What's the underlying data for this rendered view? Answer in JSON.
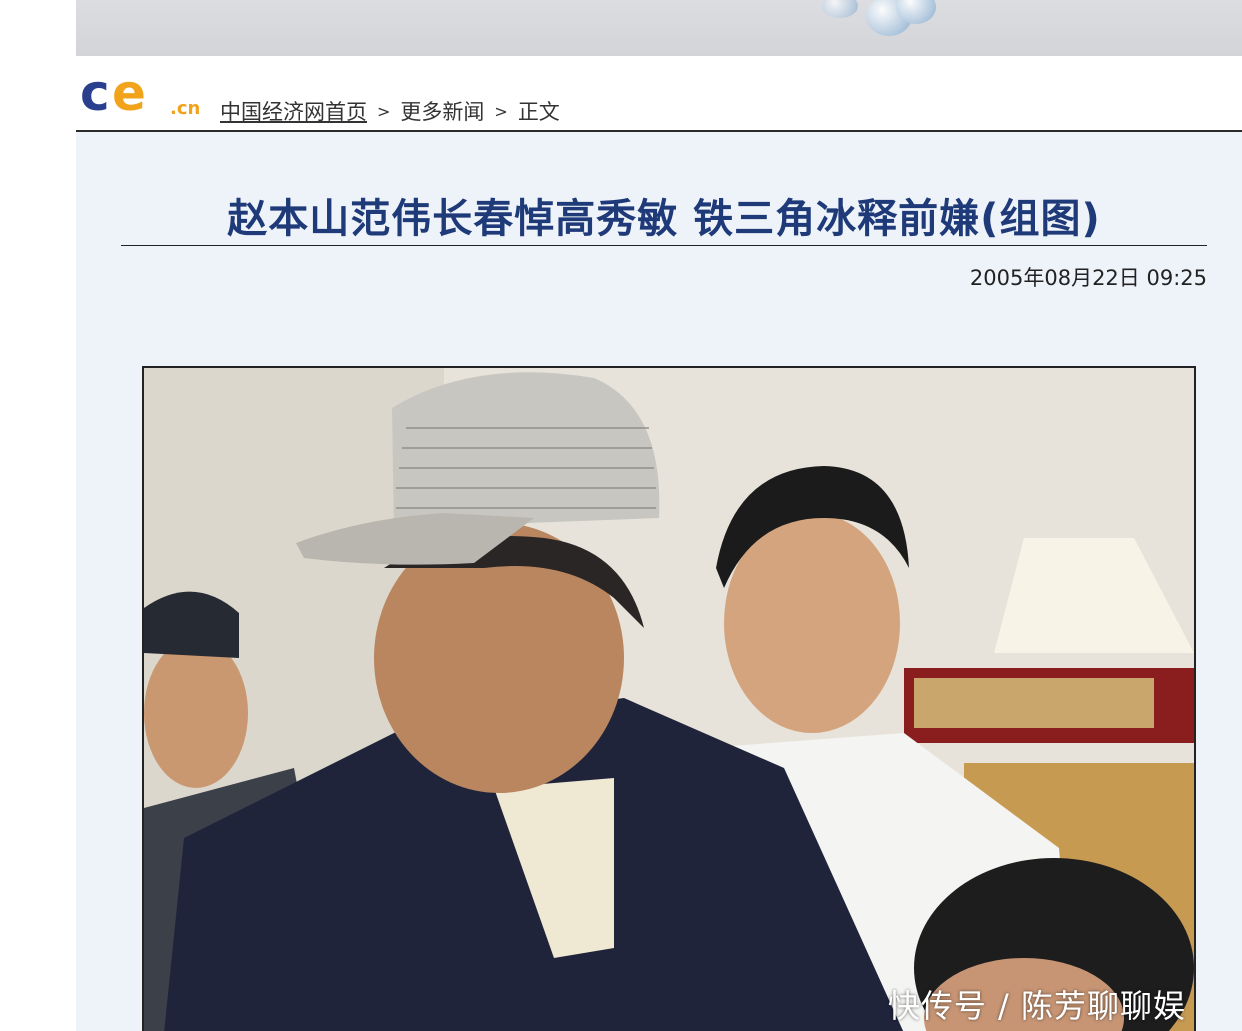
{
  "logo": {
    "mark": "ce",
    "suffix": ".cn"
  },
  "breadcrumb": {
    "home": "中国经济网首页",
    "sep1": ">",
    "more": "更多新闻",
    "sep2": ">",
    "current": "正文"
  },
  "article": {
    "title": "赵本山范伟长春悼高秀敏 铁三角冰释前嫌(组图)",
    "date": "2005年08月22日 09:25"
  },
  "watermark": "快传号 / 陈芳聊聊娱",
  "colors": {
    "title": "#1f3a78",
    "logo_blue": "#2b3f8f",
    "logo_orange": "#f2a31c"
  }
}
